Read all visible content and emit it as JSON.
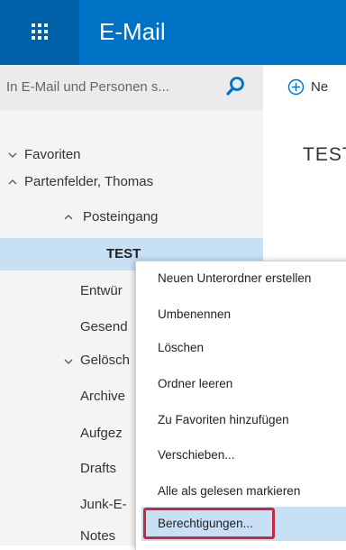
{
  "topbar": {
    "app_title": "E-Mail",
    "colors": {
      "bar": "#0072c6",
      "waffle": "#0060a8"
    },
    "waffle_icon": "app-launcher-icon"
  },
  "search": {
    "placeholder": "In E-Mail und Personen s...",
    "icon": "search-icon"
  },
  "toolbar": {
    "new_label": "Ne",
    "new_icon": "plus-circle-icon"
  },
  "folders": [
    {
      "label": "Favoriten",
      "expanded": false
    },
    {
      "label": "Partenfelder, Thomas",
      "expanded": true
    },
    {
      "label": "Posteingang",
      "expanded": true
    },
    {
      "label": "TEST",
      "selected": true
    },
    {
      "label": "Entwür"
    },
    {
      "label": "Gesend"
    },
    {
      "label": "Gelösch",
      "expanded": false
    },
    {
      "label": "Archive"
    },
    {
      "label": "Aufgez"
    },
    {
      "label": "Drafts"
    },
    {
      "label": "Junk-E-"
    },
    {
      "label": "Notes"
    }
  ],
  "main": {
    "folder_header": "TEST"
  },
  "context_menu": {
    "items": [
      "Neuen Unterordner erstellen",
      "Umbenennen",
      "Löschen",
      "Ordner leeren",
      "Zu Favoriten hinzufügen",
      "Verschieben...",
      "Alle als gelesen markieren",
      "Berechtigungen..."
    ],
    "highlighted_index": 7,
    "highlight_border_color": "#c8283d",
    "highlight_bg_color": "#c7e0f4"
  }
}
